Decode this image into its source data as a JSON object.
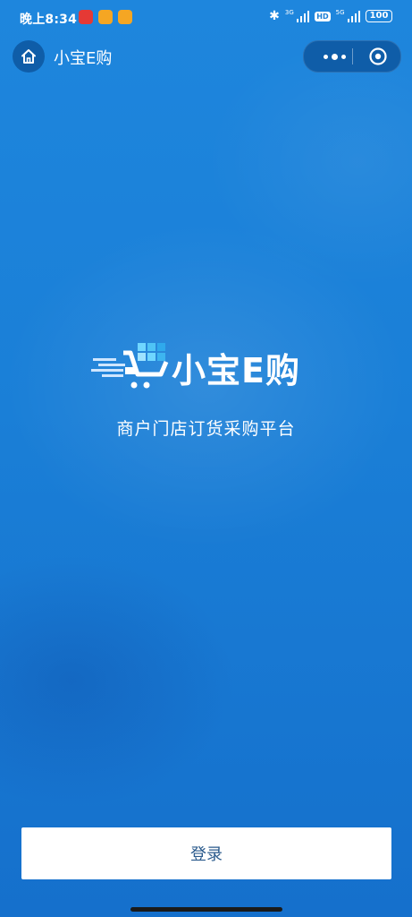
{
  "status_bar": {
    "time": "晚上8:34",
    "network_left": "3G",
    "hd": "HD",
    "network_right": "5G",
    "battery": "100"
  },
  "nav": {
    "title": "小宝E购"
  },
  "brand": {
    "name": "小宝E购",
    "slogan": "商户门店订货采购平台"
  },
  "actions": {
    "login_label": "登录"
  },
  "icons": {
    "home": "home-icon",
    "more": "more-dots-icon",
    "close": "close-circle-icon",
    "logo": "shopping-cart-logo-icon",
    "bluetooth": "bluetooth-icon"
  },
  "colors": {
    "background": "#1b7fd6",
    "capsule": "#0f5da8",
    "button_text": "#2a5a8c"
  }
}
